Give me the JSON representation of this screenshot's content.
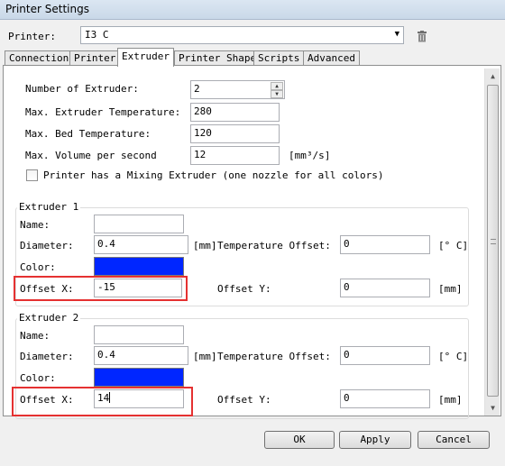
{
  "window": {
    "title": "Printer Settings"
  },
  "printer": {
    "label": "Printer:",
    "selected": "I3 C"
  },
  "tabs": [
    {
      "label": "Connection"
    },
    {
      "label": "Printer"
    },
    {
      "label": "Extruder"
    },
    {
      "label": "Printer Shape"
    },
    {
      "label": "Scripts"
    },
    {
      "label": "Advanced"
    }
  ],
  "extruder_tab": {
    "num_extruder_label": "Number of Extruder:",
    "num_extruder_value": "2",
    "max_extruder_temp_label": "Max. Extruder Temperature:",
    "max_extruder_temp_value": "280",
    "max_bed_temp_label": "Max. Bed Temperature:",
    "max_bed_temp_value": "120",
    "max_volume_label": "Max. Volume per second",
    "max_volume_value": "12",
    "max_volume_unit": "[mm³/s]",
    "mixing_label": "Printer has a Mixing Extruder (one nozzle for all colors)",
    "mixing_checked": false
  },
  "extruders": [
    {
      "title": "Extruder 1",
      "name_label": "Name:",
      "name_value": "",
      "diameter_label": "Diameter:",
      "diameter_value": "0.4",
      "diameter_unit": "[mm]",
      "temp_offset_label": "Temperature Offset:",
      "temp_offset_value": "0",
      "temp_offset_unit": "[° C]",
      "color_label": "Color:",
      "color": "#0026ff",
      "offset_x_label": "Offset X:",
      "offset_x_value": "-15",
      "offset_y_label": "Offset Y:",
      "offset_y_value": "0",
      "offset_y_unit": "[mm]"
    },
    {
      "title": "Extruder 2",
      "name_label": "Name:",
      "name_value": "",
      "diameter_label": "Diameter:",
      "diameter_value": "0.4",
      "diameter_unit": "[mm]",
      "temp_offset_label": "Temperature Offset:",
      "temp_offset_value": "0",
      "temp_offset_unit": "[° C]",
      "color_label": "Color:",
      "color": "#0026ff",
      "offset_x_label": "Offset X:",
      "offset_x_value": "14",
      "offset_y_label": "Offset Y:",
      "offset_y_value": "0",
      "offset_y_unit": "[mm]"
    }
  ],
  "buttons": {
    "ok": "OK",
    "apply": "Apply",
    "cancel": "Cancel"
  },
  "colors": {
    "highlight": "#e53131",
    "extruder_color": "#0026ff"
  }
}
